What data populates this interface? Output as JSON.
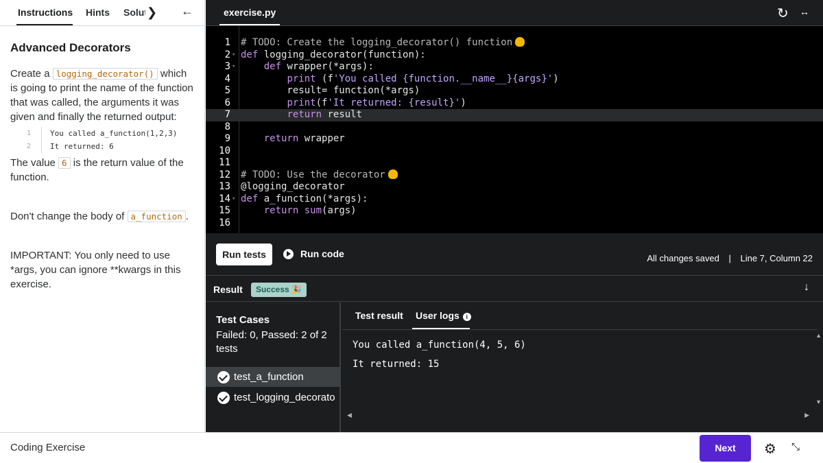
{
  "left_panel": {
    "tabs": [
      "Instructions",
      "Hints",
      "Solut"
    ],
    "title": "Advanced Decorators",
    "para1_pre": "Create a ",
    "para1_code": "logging_decorator()",
    "para1_post": " which is going to print the name of the function that was called, the arguments it was given and finally the returned output:",
    "snippet": [
      {
        "n": "1",
        "text": "You called a_function(1,2,3)"
      },
      {
        "n": "2",
        "text": "It returned: 6"
      }
    ],
    "para2_pre": "The value ",
    "para2_code": "6",
    "para2_post": " is the return value of the function.",
    "para3_pre": "Don't change the body of ",
    "para3_code": "a_function",
    "para3_post": ".",
    "para4": "IMPORTANT: You only need to use *args, you can ignore **kwargs in this exercise.",
    "footer": "Coding Exercise"
  },
  "editor": {
    "filename": "exercise.py",
    "active_line": 7
  },
  "actions": {
    "run_tests": "Run tests",
    "run_code": "Run code",
    "status": "All changes saved",
    "separator": "|",
    "position": "Line 7, Column 22"
  },
  "result": {
    "label": "Result",
    "badge": "Success 🎉",
    "test_cases_title": "Test Cases",
    "test_cases_summary": "Failed: 0, Passed: 2 of 2 tests",
    "tests": [
      "test_a_function",
      "test_logging_decorato"
    ],
    "tabs": [
      "Test result",
      "User logs"
    ],
    "logs": [
      "You called a_function(4, 5, 6)",
      "It returned: 15"
    ]
  },
  "footer": {
    "next": "Next"
  },
  "colors": {
    "accent": "#5624d0",
    "success_bg": "#acd2cc",
    "editor_bg": "#000000",
    "panel_bg": "#1c1d1f"
  }
}
